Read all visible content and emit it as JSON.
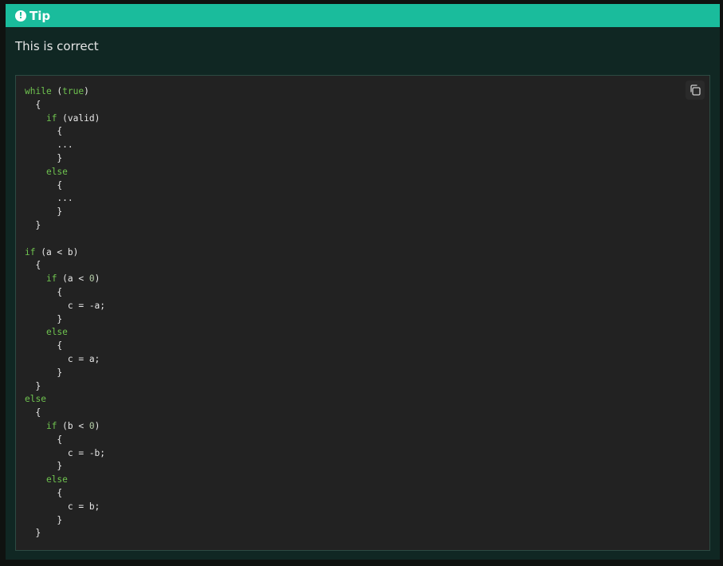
{
  "admonition": {
    "title": "Tip",
    "icon": "exclamation-circle-icon",
    "header_color": "#1abc9c",
    "body_color": "#102723",
    "text": "This is correct"
  },
  "code_block": {
    "copy_icon": "copy-icon",
    "background": "#222222",
    "keyword_color": "#6fc34f",
    "lines": [
      "while (true)",
      "  {",
      "    if (valid)",
      "      {",
      "      ...",
      "      }",
      "    else",
      "      {",
      "      ...",
      "      }",
      "  }",
      "",
      "if (a < b)",
      "  {",
      "    if (a < 0)",
      "      {",
      "        c = -a;",
      "      }",
      "    else",
      "      {",
      "        c = a;",
      "      }",
      "  }",
      "else",
      "  {",
      "    if (b < 0)",
      "      {",
      "        c = -b;",
      "      }",
      "    else",
      "      {",
      "        c = b;",
      "      }",
      "  }"
    ]
  }
}
